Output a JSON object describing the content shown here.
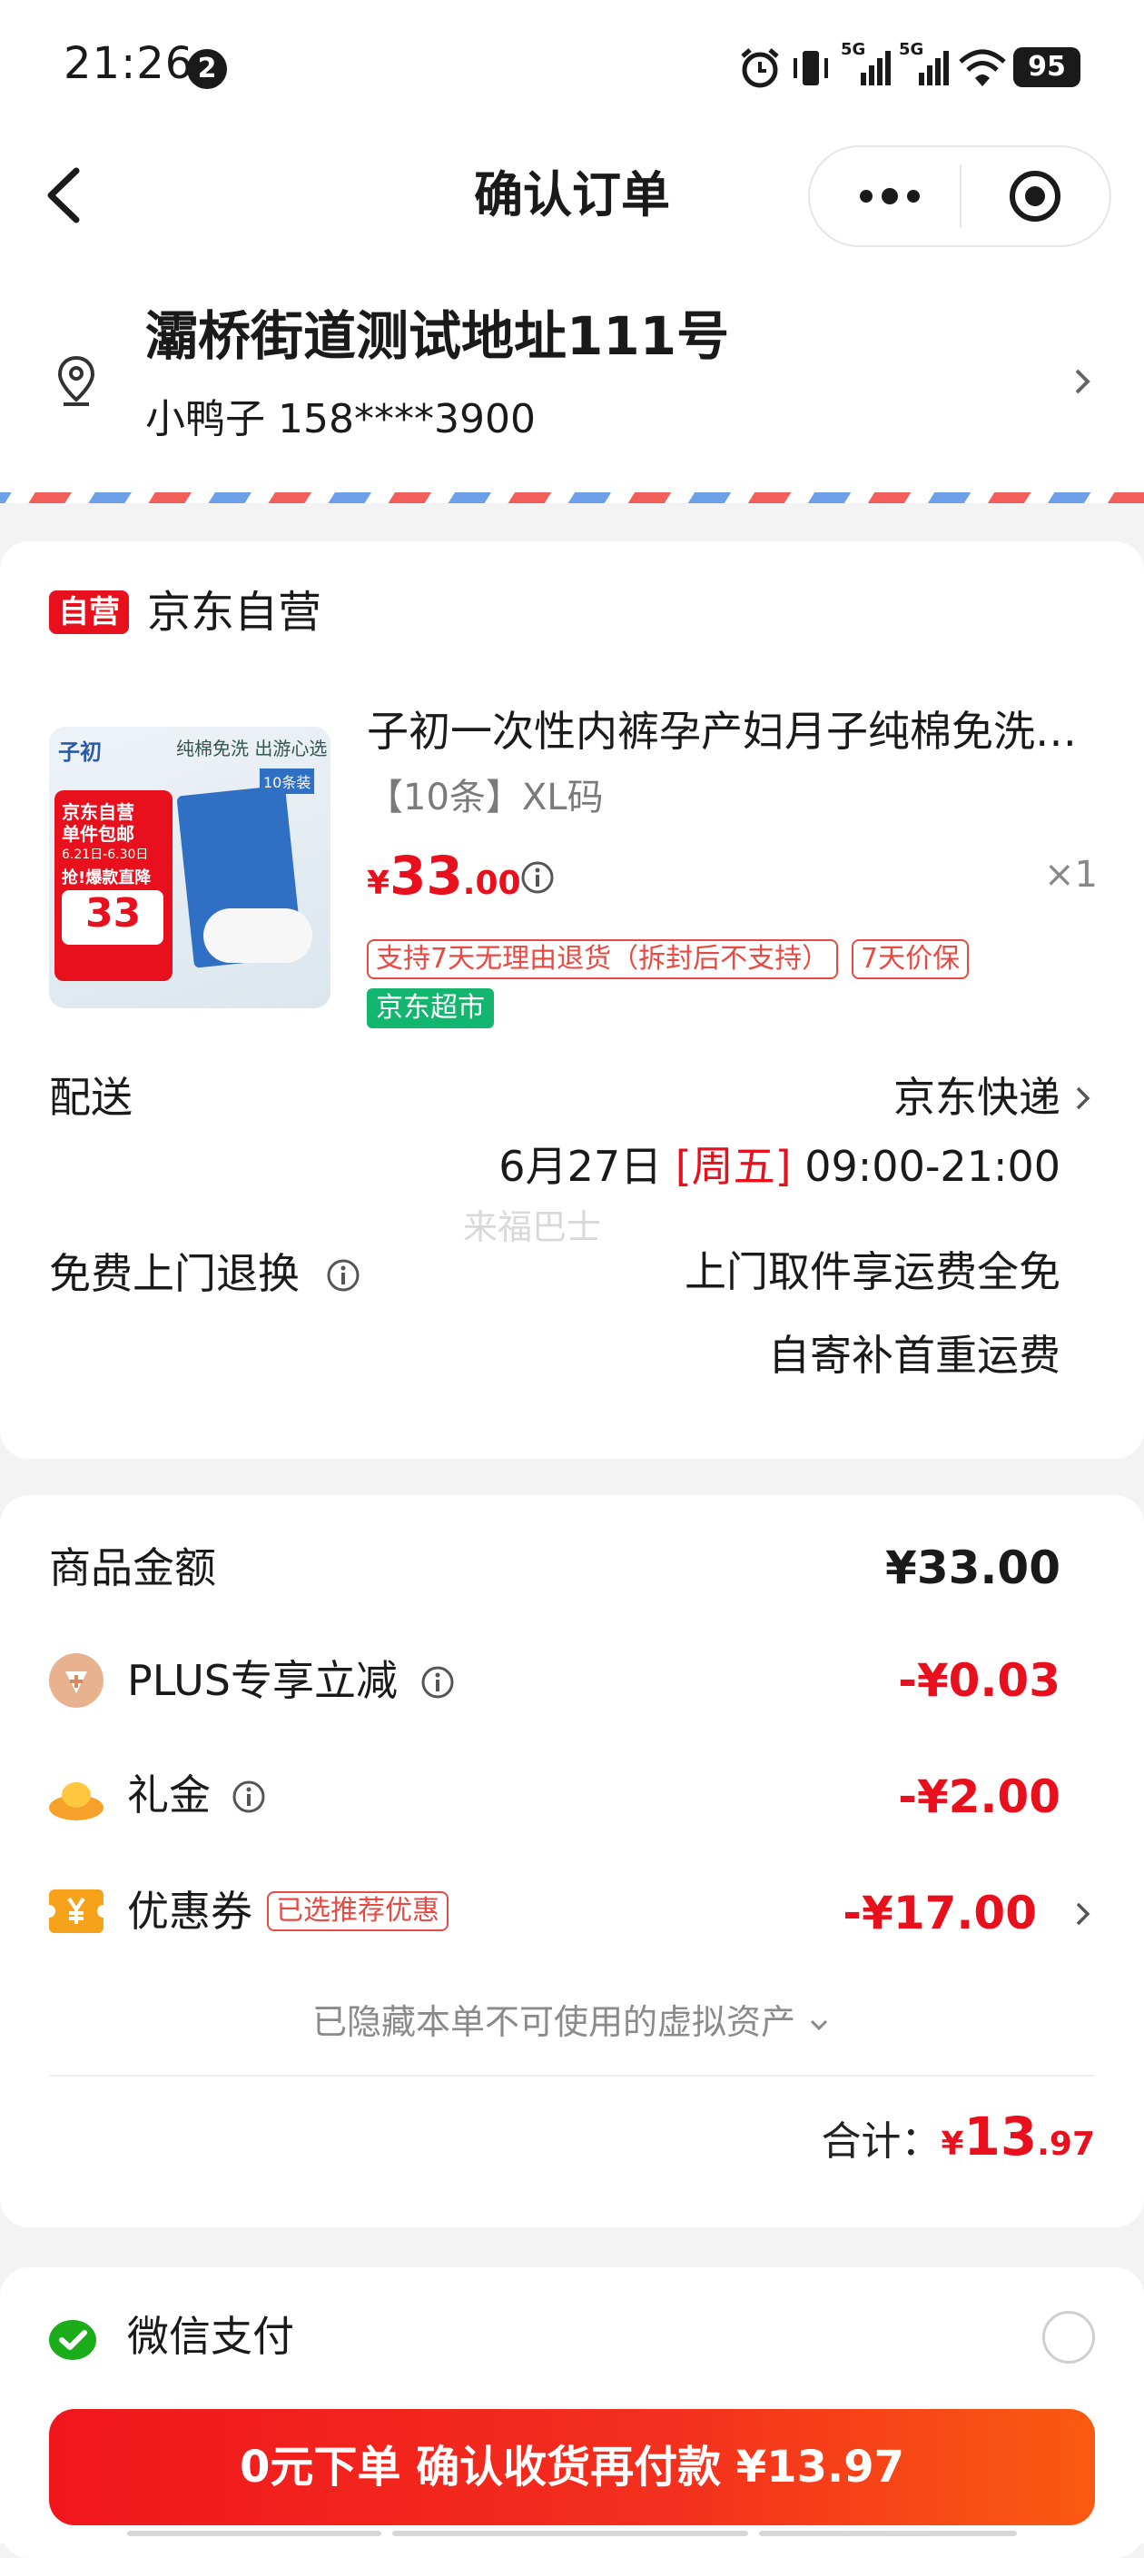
{
  "status_bar": {
    "time": "21:26",
    "notification_count": "2",
    "network_1": "5G",
    "network_2": "5G",
    "battery": "95"
  },
  "nav": {
    "title": "确认订单"
  },
  "address": {
    "line": "灞桥街道测试地址111号",
    "contact": "小鸭子 158****3900"
  },
  "shop": {
    "badge": "自营",
    "name": "京东自营",
    "product": {
      "title": "子初一次性内裤孕产妇月子纯棉免洗…",
      "spec": "【10条】XL码",
      "price_symbol": "¥",
      "price_int": "33",
      "price_dec": ".00",
      "quantity": "×1",
      "tags": [
        "支持7天无理由退货（拆封后不支持）",
        "7天价保"
      ],
      "channel_tag": "京东超市",
      "image_text": {
        "brand": "子初",
        "banner": "纯棉免洗 出游心选",
        "promo_1": "京东自营",
        "promo_2": "单件包邮",
        "date": "6.21日-6.30日",
        "promo_3": "抢!爆款直降",
        "promo_price": "33",
        "pack": "10条装"
      }
    },
    "delivery": {
      "label": "配送",
      "method": "京东快递",
      "date": "6月27日",
      "weekday": "[周五]",
      "time": "09:00-21:00"
    },
    "watermark": "来福巴士",
    "return": {
      "label": "免费上门退换",
      "line1": "上门取件享运费全免",
      "line2": "自寄补首重运费"
    }
  },
  "amounts": {
    "goods_label": "商品金额",
    "goods_value": "¥33.00",
    "plus_label": "PLUS专享立减",
    "plus_value": "-¥0.03",
    "gift_label": "礼金",
    "gift_value": "-¥2.00",
    "coupon_label": "优惠券",
    "coupon_tag": "已选推荐优惠",
    "coupon_value": "-¥17.00",
    "hidden_assets": "已隐藏本单不可使用的虚拟资产",
    "total_label": "合计：",
    "total_symbol": "¥",
    "total_int": "13",
    "total_dec": ".97"
  },
  "payment": {
    "method": "微信支付"
  },
  "submit": {
    "label": "0元下单 确认收货再付款 ¥13.97"
  },
  "colors": {
    "accent_red": "#e8101c",
    "wechat_green": "#1aad19",
    "jd_supermarket_green": "#13b66e"
  }
}
